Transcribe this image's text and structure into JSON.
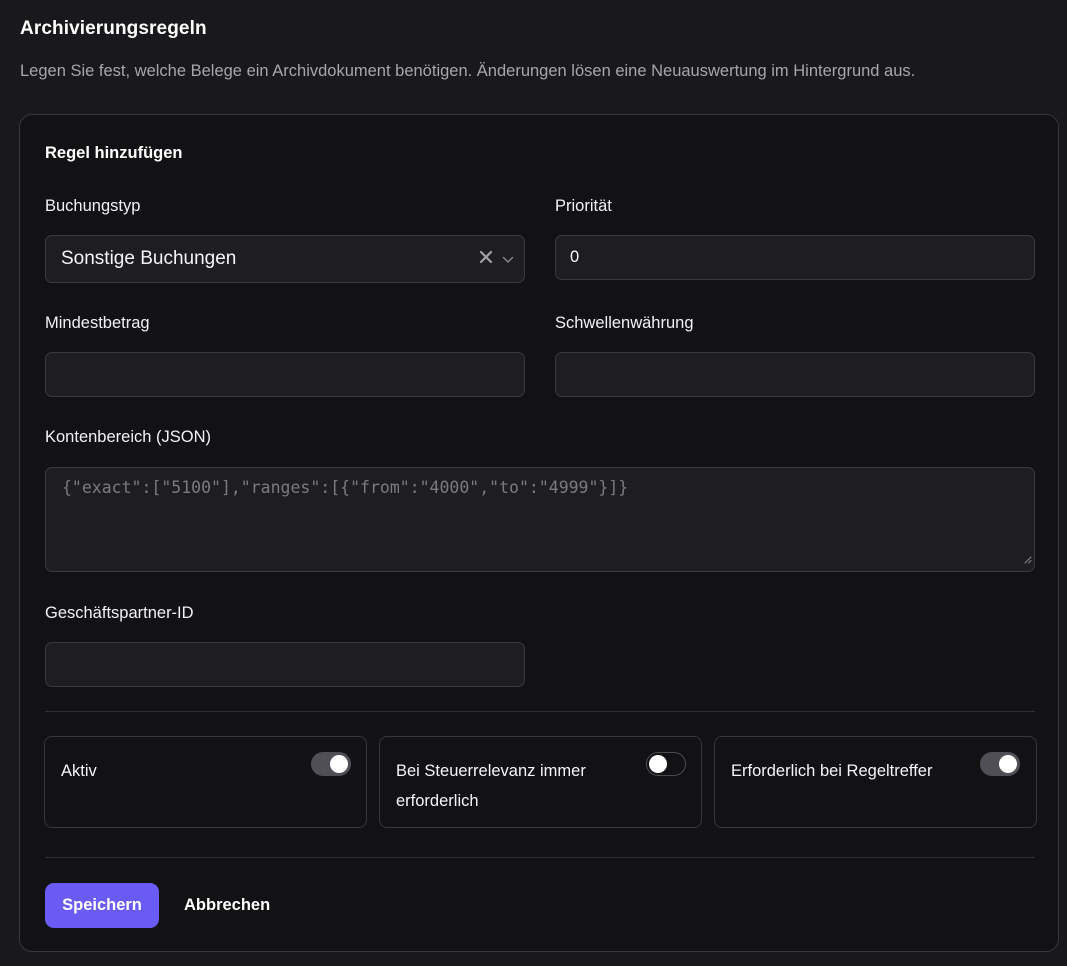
{
  "header": {
    "title": "Archivierungsregeln",
    "description": "Legen Sie fest, welche Belege ein Archivdokument benötigen. Änderungen lösen eine Neuauswertung im Hintergrund aus."
  },
  "form": {
    "title": "Regel hinzufügen",
    "booking_type": {
      "label": "Buchungstyp",
      "value": "Sonstige Buchungen",
      "clear_icon": "close-icon",
      "dropdown_icon": "chevron-down-icon"
    },
    "priority": {
      "label": "Priorität",
      "value": "0"
    },
    "min_amount": {
      "label": "Mindestbetrag",
      "value": ""
    },
    "threshold_currency": {
      "label": "Schwellenwährung",
      "value": ""
    },
    "account_range": {
      "label": "Kontenbereich (JSON)",
      "placeholder": "{\"exact\":[\"5100\"],\"ranges\":[{\"from\":\"4000\",\"to\":\"4999\"}]}",
      "value": ""
    },
    "partner_id": {
      "label": "Geschäftspartner-ID",
      "value": ""
    },
    "toggles": [
      {
        "label": "Aktiv",
        "on": true
      },
      {
        "label": "Bei Steuerrelevanz immer erforderlich",
        "on": false
      },
      {
        "label": "Erforderlich bei Regeltreffer",
        "on": true
      }
    ],
    "save_label": "Speichern",
    "cancel_label": "Abbrechen"
  },
  "colors": {
    "background": "#19191b",
    "card": "#121214",
    "input": "#1e1e21",
    "border": "#36363b",
    "accent": "#6a5bf5",
    "muted_text": "#a6a6ab"
  }
}
